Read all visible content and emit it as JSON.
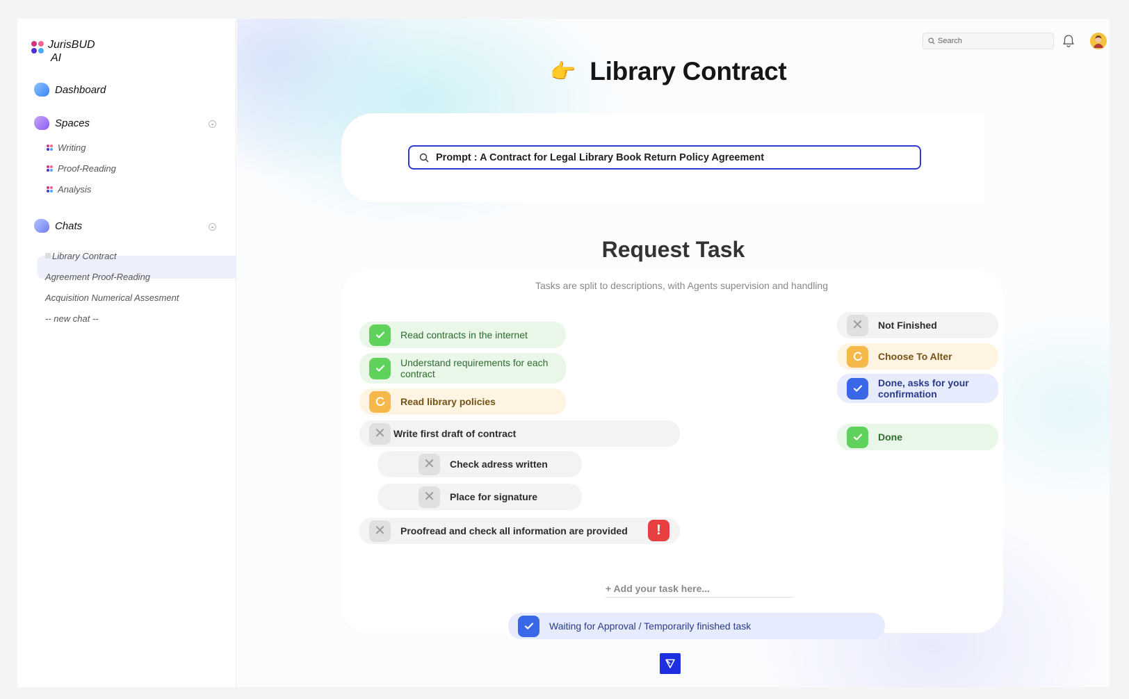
{
  "app": {
    "logo_line1": "JurisBUD",
    "logo_line2": "AI"
  },
  "sidebar": {
    "dashboard": "Dashboard",
    "spaces": {
      "label": "Spaces",
      "items": [
        "Writing",
        "Proof-Reading",
        "Analysis"
      ]
    },
    "chats": {
      "label": "Chats",
      "items": [
        "Library Contract",
        "Agreement Proof-Reading",
        "Acquisition Numerical Assesment",
        "-- new chat --"
      ]
    }
  },
  "header": {
    "search_placeholder": "Search"
  },
  "page": {
    "title": "Library Contract",
    "title_emoji": "👉",
    "prompt": "Prompt : A Contract for Legal Library Book Return Policy Agreement"
  },
  "request_task": {
    "title": "Request Task",
    "subtitle": "Tasks are split to descriptions, with Agents supervision and handling",
    "tasks": [
      {
        "label": "Read contracts in the internet",
        "status": "done"
      },
      {
        "label": "Understand requirements for each contract",
        "status": "done"
      },
      {
        "label": "Read library policies",
        "status": "alter"
      },
      {
        "label": "Write first draft of contract",
        "status": "not_finished"
      },
      {
        "label": "Check adress written",
        "status": "not_finished"
      },
      {
        "label": "Place for signature",
        "status": "not_finished"
      },
      {
        "label": "Proofread and check all information are provided",
        "status": "not_finished",
        "alert": "!"
      }
    ],
    "add_placeholder": "+ Add your task here...",
    "waiting_label": "Waiting for Approval / Temporarily finished task"
  },
  "legend": [
    {
      "label": "Not Finished",
      "status": "not_finished"
    },
    {
      "label": "Choose To Alter",
      "status": "alter"
    },
    {
      "label": "Done, asks for your confirmation",
      "status": "confirm"
    },
    {
      "label": "Done",
      "status": "done"
    }
  ],
  "colors": {
    "accent": "#1f2fe0",
    "done": "#5fd25c",
    "alter": "#f7b84a",
    "confirm": "#3a67e8",
    "not_finished": "#e0e0e0",
    "alert": "#e84040"
  }
}
